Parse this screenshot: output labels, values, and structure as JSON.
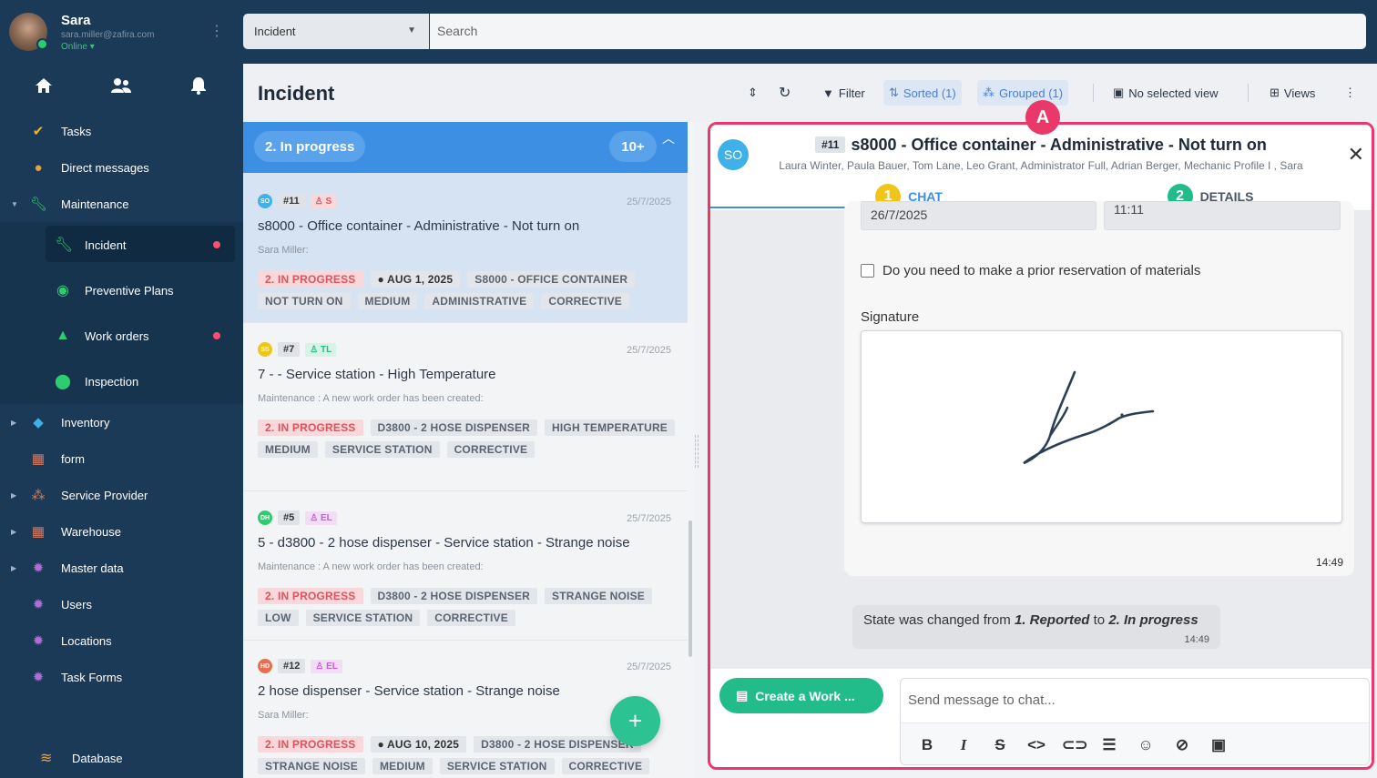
{
  "user": {
    "name": "Sara",
    "email": "sara.miller@zafira.com",
    "status": "Online"
  },
  "nav": {
    "tasks": "Tasks",
    "direct_messages": "Direct messages",
    "maintenance": "Maintenance",
    "maintenance_sub": {
      "incident": "Incident",
      "preventive": "Preventive Plans",
      "work_orders": "Work orders",
      "inspection": "Inspection"
    },
    "inventory": "Inventory",
    "form": "form",
    "service_provider": "Service Provider",
    "warehouse": "Warehouse",
    "master_data": "Master data",
    "users": "Users",
    "locations": "Locations",
    "task_forms": "Task Forms",
    "database": "Database"
  },
  "topbar": {
    "module": "Incident",
    "search_placeholder": "Search"
  },
  "header": {
    "title": "Incident",
    "filter": "Filter",
    "sorted": "Sorted (1)",
    "grouped": "Grouped (1)",
    "no_view": "No selected view",
    "views": "Views"
  },
  "group": {
    "label": "2. In progress",
    "count": "10+"
  },
  "cards": [
    {
      "initials": "SO",
      "id": "#11",
      "assignee": "S",
      "date": "25/7/2025",
      "title": "s8000 - Office container - Administrative - Not turn on",
      "subtitle": "Sara Miller:",
      "tags": [
        "2. IN PROGRESS",
        "AUG 1, 2025",
        "S8000 - OFFICE CONTAINER",
        "NOT TURN ON",
        "MEDIUM",
        "ADMINISTRATIVE",
        "CORRECTIVE"
      ]
    },
    {
      "initials": "SS",
      "id": "#7",
      "assignee": "TL",
      "date": "25/7/2025",
      "title": "7 - - Service station - High Temperature",
      "subtitle": "Maintenance : A new work order has been created:",
      "tags": [
        "2. IN PROGRESS",
        "D3800 - 2 HOSE DISPENSER",
        "HIGH TEMPERATURE",
        "MEDIUM",
        "SERVICE STATION",
        "CORRECTIVE"
      ]
    },
    {
      "initials": "DH",
      "id": "#5",
      "assignee": "EL",
      "date": "25/7/2025",
      "title": "5 - d3800 - 2 hose dispenser - Service station - Strange noise",
      "subtitle": "Maintenance : A new work order has been created:",
      "tags": [
        "2. IN PROGRESS",
        "D3800 - 2 HOSE DISPENSER",
        "STRANGE NOISE",
        "LOW",
        "SERVICE STATION",
        "CORRECTIVE"
      ]
    },
    {
      "initials": "HD",
      "id": "#12",
      "assignee": "EL",
      "date": "25/7/2025",
      "title": "2 hose dispenser - Service station - Strange noise",
      "subtitle": "Sara Miller:",
      "tags": [
        "2. IN PROGRESS",
        "AUG 10, 2025",
        "D3800 - 2 HOSE DISPENSER",
        "STRANGE NOISE",
        "MEDIUM",
        "SERVICE STATION",
        "CORRECTIVE"
      ]
    }
  ],
  "detail": {
    "avatar": "SO",
    "id": "#11",
    "title": "s8000 - Office container - Administrative - Not turn on",
    "participants": "Laura Winter, Paula Bauer, Tom Lane, Leo Grant, Administrator Full, Adrian Berger, Mechanic Profile I , Sara",
    "tab_chat": "CHAT",
    "tab_details": "DETAILS",
    "tab_chat_num": "1",
    "tab_details_num": "2",
    "date_value": "26/7/2025",
    "time_value": "11:11",
    "checkbox_label": "Do you need to make a prior reservation of materials",
    "signature_label": "Signature",
    "bubble_time": "14:49",
    "state_prefix": "State was changed from ",
    "state_from": "1. Reported",
    "state_mid": " to ",
    "state_to": "2. In progress",
    "state_time": "14:49",
    "create_work": "Create a Work ...",
    "message_placeholder": "Send message to chat..."
  },
  "badge_a": "A",
  "colors": {
    "sidebar": "#1b3a57",
    "accent": "#3d8fe3",
    "highlight": "#e9386a",
    "green": "#22bb8a",
    "tag_red": "#e0525c"
  }
}
